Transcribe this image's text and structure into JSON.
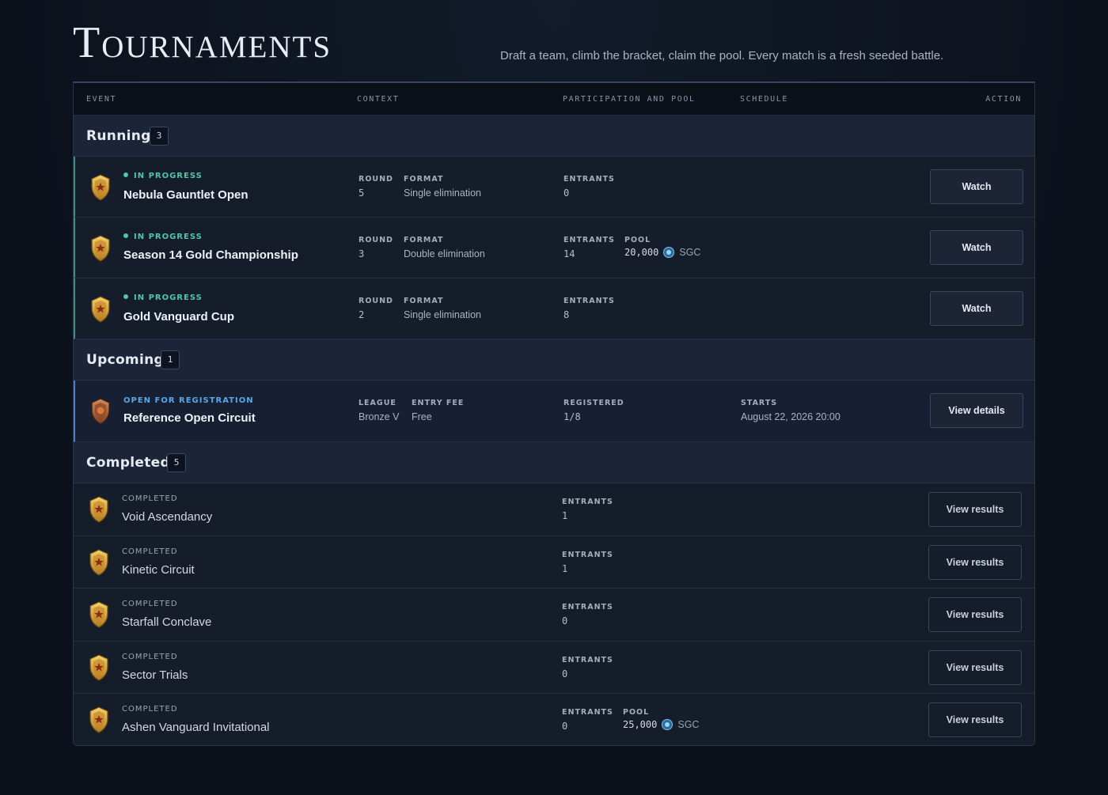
{
  "page": {
    "title": "Tournaments",
    "subtitle": "Draft a team, climb the bracket, claim the pool. Every match is a fresh seeded battle."
  },
  "columns": {
    "event": "EVENT",
    "context": "CONTEXT",
    "participation": "PARTICIPATION AND POOL",
    "schedule": "SCHEDULE",
    "action": "ACTION"
  },
  "groups": {
    "running": {
      "label": "Running",
      "count": "3",
      "rows": [
        {
          "status": "IN PROGRESS",
          "name": "Nebula Gauntlet Open",
          "round_label": "ROUND",
          "round": "5",
          "format_label": "FORMAT",
          "format": "Single elimination",
          "entrants_label": "ENTRANTS",
          "entrants": "0",
          "action": "Watch"
        },
        {
          "status": "IN PROGRESS",
          "name": "Season 14 Gold Championship",
          "round_label": "ROUND",
          "round": "3",
          "format_label": "FORMAT",
          "format": "Double elimination",
          "entrants_label": "ENTRANTS",
          "entrants": "14",
          "pool_label": "POOL",
          "pool": "20,000",
          "currency": "SGC",
          "action": "Watch"
        },
        {
          "status": "IN PROGRESS",
          "name": "Gold Vanguard Cup",
          "round_label": "ROUND",
          "round": "2",
          "format_label": "FORMAT",
          "format": "Single elimination",
          "entrants_label": "ENTRANTS",
          "entrants": "8",
          "action": "Watch"
        }
      ]
    },
    "upcoming": {
      "label": "Upcoming",
      "count": "1",
      "rows": [
        {
          "status": "OPEN FOR REGISTRATION",
          "name": "Reference Open Circuit",
          "league_label": "LEAGUE",
          "league": "Bronze V",
          "fee_label": "ENTRY FEE",
          "fee": "Free",
          "registered_label": "REGISTERED",
          "registered": "1/8",
          "starts_label": "STARTS",
          "starts": "August 22, 2026 20:00",
          "action": "View details"
        }
      ]
    },
    "completed": {
      "label": "Completed",
      "count": "5",
      "rows": [
        {
          "status": "COMPLETED",
          "name": "Void Ascendancy",
          "entrants_label": "ENTRANTS",
          "entrants": "1",
          "action": "View results"
        },
        {
          "status": "COMPLETED",
          "name": "Kinetic Circuit",
          "entrants_label": "ENTRANTS",
          "entrants": "1",
          "action": "View results"
        },
        {
          "status": "COMPLETED",
          "name": "Starfall Conclave",
          "entrants_label": "ENTRANTS",
          "entrants": "0",
          "action": "View results"
        },
        {
          "status": "COMPLETED",
          "name": "Sector Trials",
          "entrants_label": "ENTRANTS",
          "entrants": "0",
          "action": "View results"
        },
        {
          "status": "COMPLETED",
          "name": "Ashen Vanguard Invitational",
          "entrants_label": "ENTRANTS",
          "entrants": "0",
          "pool_label": "POOL",
          "pool": "25,000",
          "currency": "SGC",
          "action": "View results"
        }
      ]
    }
  },
  "icons": {
    "gold_badge": "gold-shield-badge-icon",
    "bronze_badge": "bronze-shield-badge-icon",
    "coin": "sgc-coin-icon"
  },
  "colors": {
    "running_accent": "#3d8f82",
    "upcoming_accent": "#4b7fc6",
    "live_status": "#4fc7a4",
    "registration_status": "#5aa6e8"
  }
}
